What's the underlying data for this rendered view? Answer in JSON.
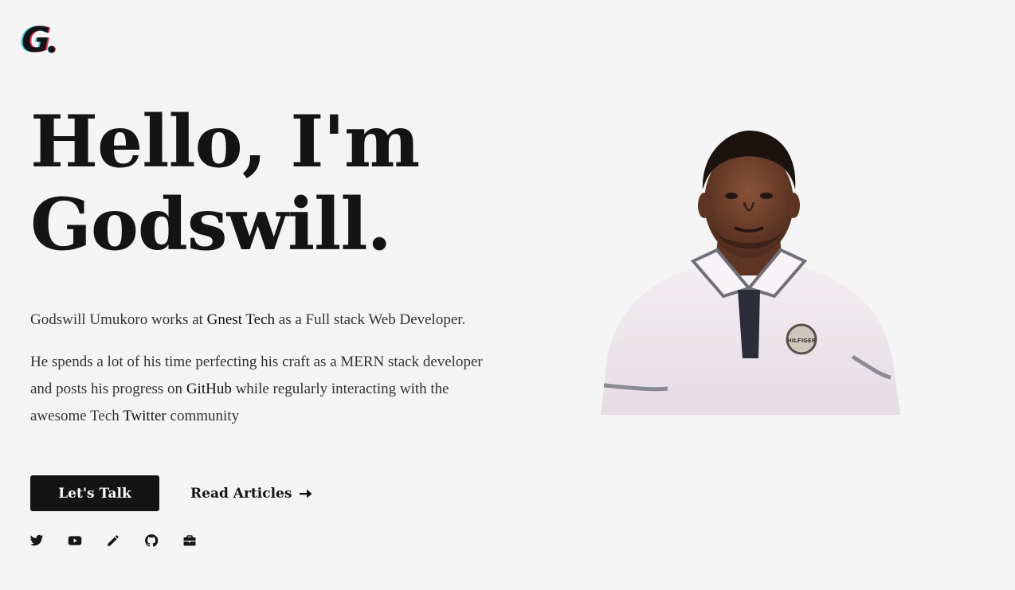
{
  "logo": {
    "letter": "G",
    "colors": {
      "main": "#141414",
      "pink": "#e8325e",
      "cyan": "#2ec4c9"
    }
  },
  "hero": {
    "title_line1": "Hello, I'm",
    "title_line2": "Godswill."
  },
  "bio": {
    "p1_before": "Godswill Umukoro works at ",
    "p1_link": "Gnest Tech",
    "p1_after": " as a Full stack Web Developer.",
    "p2_before": "He spends a lot of his time perfecting his craft as a MERN stack developer and posts his progress on ",
    "p2_link1": "GitHub",
    "p2_middle": " while regularly interacting with the awesome Tech ",
    "p2_link2": "Twitter",
    "p2_after": " community"
  },
  "actions": {
    "primary_label": "Let's Talk",
    "secondary_label": "Read Articles",
    "secondary_icon": "arrow-right-icon"
  },
  "socials": [
    {
      "name": "twitter-icon"
    },
    {
      "name": "youtube-icon"
    },
    {
      "name": "pencil-icon"
    },
    {
      "name": "github-icon"
    },
    {
      "name": "briefcase-icon"
    }
  ],
  "portrait": {
    "shirt_badge": "HILFIGER"
  },
  "colors": {
    "background": "#f4f4f4",
    "text": "#141414",
    "button": "#141414"
  }
}
